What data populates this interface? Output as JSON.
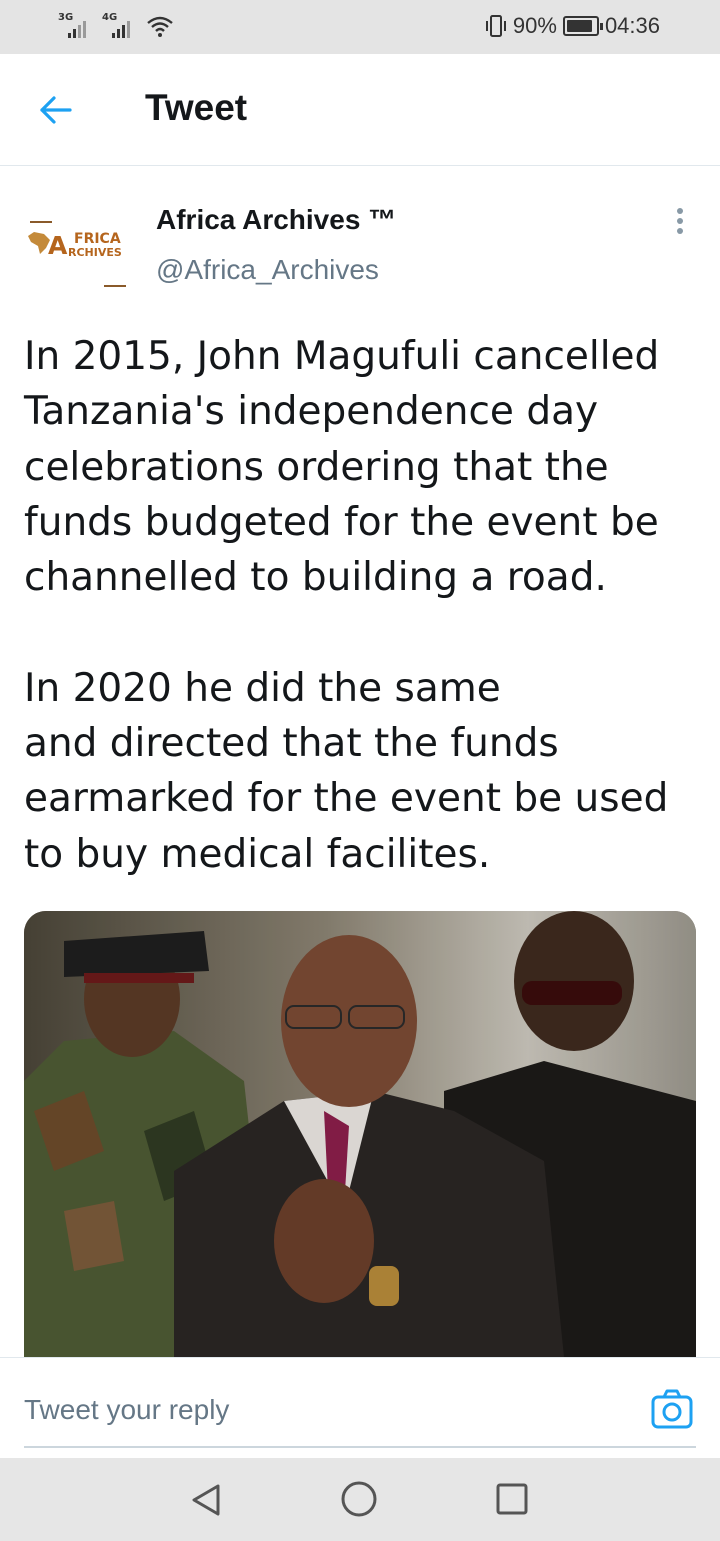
{
  "status_bar": {
    "network_1": "3G",
    "network_2": "4G",
    "battery_percent": "90%",
    "battery_level": 0.9,
    "time": "04:36",
    "icons": [
      "signal-icon",
      "signal-icon",
      "wifi-icon",
      "vibrate-icon",
      "battery-icon"
    ]
  },
  "header": {
    "back_icon": "arrow-left-icon",
    "title": "Tweet",
    "accent_color": "#1da1f2"
  },
  "author": {
    "name": "Africa Archives ™",
    "handle": "@Africa_Archives",
    "avatar_text_line1": "FRICA",
    "avatar_text_line2": "RCHIVES",
    "more_icon": "more-vertical-icon"
  },
  "tweet": {
    "paragraph_1": [
      "In 2015, John Magufuli cancelled",
      "Tanzania's independence day",
      "celebrations ordering that the",
      "funds budgeted for the event be",
      "channelled to building a road."
    ],
    "paragraph_2": [
      "In 2020 he did the same",
      "and directed that the funds",
      "earmarked for the event be used",
      "to buy medical facilites."
    ]
  },
  "reply": {
    "placeholder": "Tweet your reply",
    "camera_icon": "camera-icon"
  },
  "nav": {
    "back_icon": "nav-back-icon",
    "home_icon": "nav-home-icon",
    "recent_icon": "nav-recent-icon"
  }
}
